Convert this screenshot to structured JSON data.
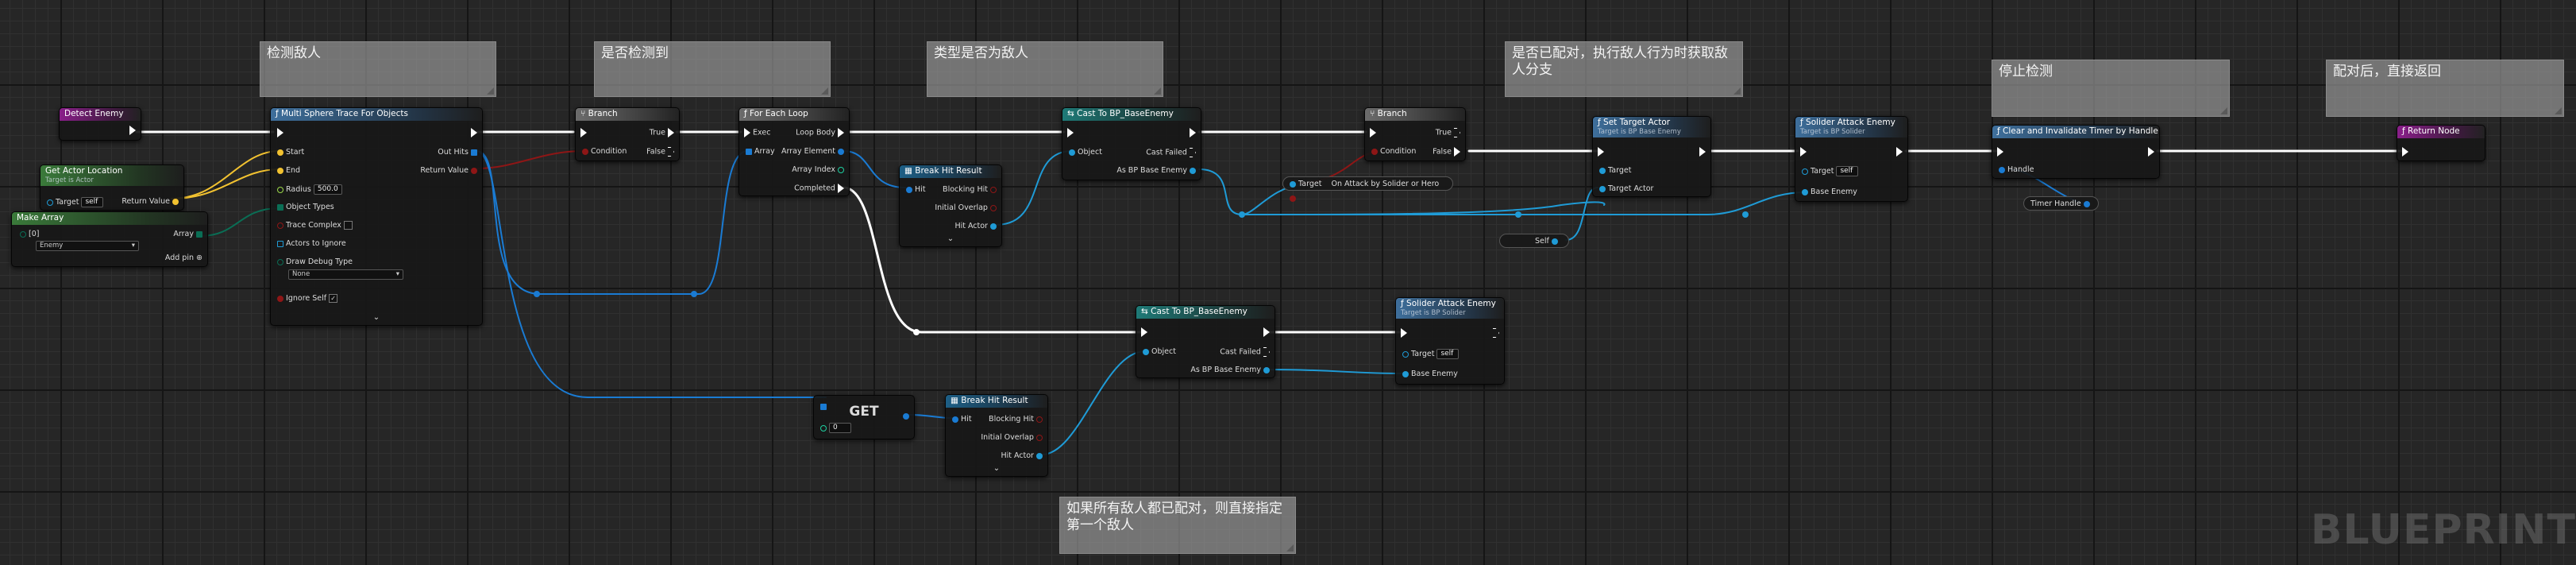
{
  "comments": [
    {
      "id": "c1",
      "text": "检测敌人"
    },
    {
      "id": "c2",
      "text": "是否检测到"
    },
    {
      "id": "c3",
      "text": "类型是否为敌人"
    },
    {
      "id": "c4",
      "text": "是否已配对，执行敌人行为时获取敌人分支"
    },
    {
      "id": "c5",
      "text": "停止检测"
    },
    {
      "id": "c6",
      "text": "配对后，直接返回"
    },
    {
      "id": "c7",
      "text": "如果所有敌人都已配对，则直接指定第一个敌人"
    }
  ],
  "nodes": {
    "detect_enemy": {
      "title": "Detect Enemy"
    },
    "get_actor_location": {
      "title": "Get Actor Location",
      "subtitle": "Target is Actor",
      "target_label": "Target",
      "target_value": "self",
      "return_label": "Return Value"
    },
    "make_array": {
      "title": "Make Array",
      "index_label": "[0]",
      "array_label": "Array",
      "enum_value": "Enemy",
      "add_pin": "Add pin"
    },
    "multi_sphere": {
      "title": "Multi Sphere Trace For Objects",
      "start": "Start",
      "end": "End",
      "radius_label": "Radius",
      "radius_value": "500.0",
      "object_types": "Object Types",
      "trace_complex": "Trace Complex",
      "actors_ignore": "Actors to Ignore",
      "draw_debug": "Draw Debug Type",
      "draw_debug_value": "None",
      "ignore_self": "Ignore Self",
      "out_hits": "Out Hits",
      "return_value": "Return Value"
    },
    "branch1": {
      "title": "Branch",
      "condition": "Condition",
      "true_label": "True",
      "false_label": "False"
    },
    "for_each": {
      "title": "For Each Loop",
      "exec": "Exec",
      "array": "Array",
      "loop_body": "Loop Body",
      "array_element": "Array Element",
      "array_index": "Array Index",
      "completed": "Completed"
    },
    "break_hit1": {
      "title": "Break Hit Result",
      "hit": "Hit",
      "blocking_hit": "Blocking Hit",
      "initial_overlap": "Initial Overlap",
      "hit_actor": "Hit Actor"
    },
    "cast1": {
      "title": "Cast To BP_BaseEnemy",
      "object": "Object",
      "cast_failed": "Cast Failed",
      "as_bp": "As BP Base Enemy"
    },
    "branch2": {
      "title": "Branch",
      "condition": "Condition",
      "true_label": "True",
      "false_label": "False"
    },
    "on_attack": {
      "label": "On Attack by Solider or Hero",
      "target": "Target"
    },
    "self_node": {
      "label": "Self"
    },
    "set_target": {
      "title": "Set Target Actor",
      "subtitle": "Target is BP Base Enemy",
      "target": "Target",
      "target_actor": "Target Actor"
    },
    "solider_attack1": {
      "title": "Solider Attack Enemy",
      "subtitle": "Target is BP Solider",
      "target": "Target",
      "target_value": "self",
      "base_enemy": "Base Enemy"
    },
    "clear_timer": {
      "title": "Clear and Invalidate Timer by Handle",
      "handle": "Handle"
    },
    "timer_handle": {
      "label": "Timer Handle"
    },
    "return_node": {
      "title": "Return Node"
    },
    "get_node": {
      "title": "GET",
      "index_value": "0"
    },
    "break_hit2": {
      "title": "Break Hit Result",
      "hit": "Hit",
      "blocking_hit": "Blocking Hit",
      "initial_overlap": "Initial Overlap",
      "hit_actor": "Hit Actor"
    },
    "cast2": {
      "title": "Cast To BP_BaseEnemy",
      "object": "Object",
      "cast_failed": "Cast Failed",
      "as_bp": "As BP Base Enemy"
    },
    "solider_attack2": {
      "title": "Solider Attack Enemy",
      "subtitle": "Target is BP Solider",
      "target": "Target",
      "target_value": "self",
      "base_enemy": "Base Enemy"
    }
  },
  "watermark": "BLUEPRINT",
  "colors": {
    "exec": "#ffffff",
    "object": "#1f9bd6",
    "vector": "#f2c230",
    "bool": "#8e1616",
    "struct": "#1a7bd3",
    "int": "#1ed0a0",
    "byte": "#0a6e55",
    "handle": "#1a7bd3"
  }
}
